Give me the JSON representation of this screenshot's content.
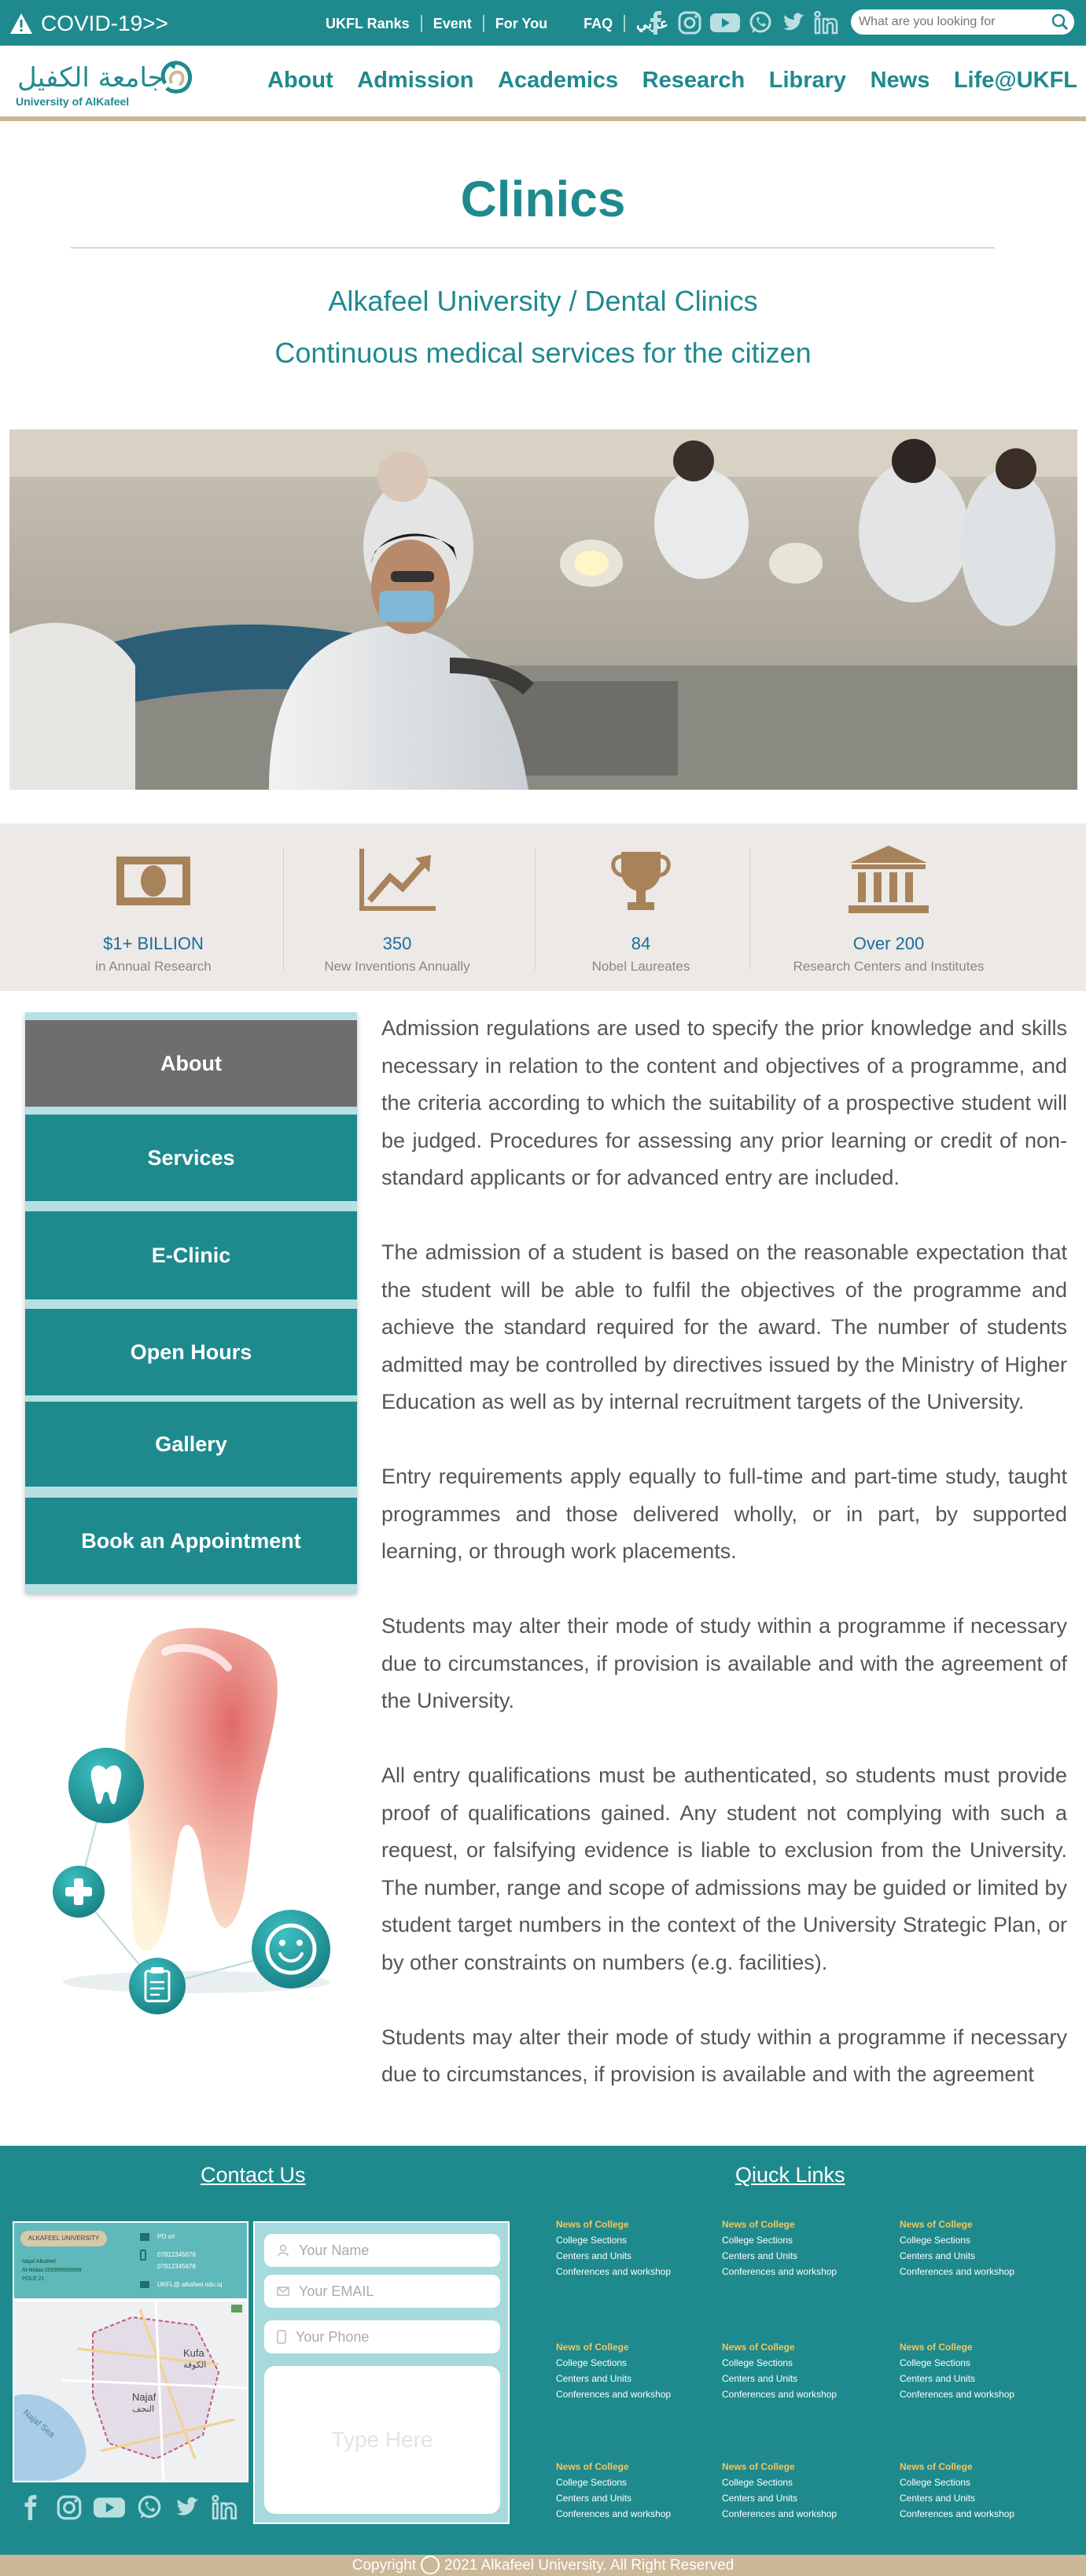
{
  "topbar": {
    "covid_label": "COVID-19>>",
    "links": [
      "UKFL Ranks",
      "Event",
      "For You",
      "FAQ",
      "عربي"
    ],
    "search_placeholder": "What are you looking for"
  },
  "logo": {
    "arabic_text": "جامعة الكفيل",
    "english_text": "University of AlKafeel"
  },
  "nav": [
    "About",
    "Admission",
    "Academics",
    "Research",
    "Library",
    "News",
    "Life@UKFL"
  ],
  "page": {
    "title": "Clinics",
    "subtitle1": "Alkafeel University / Dental Clinics",
    "subtitle2": "Continuous medical services for the citizen"
  },
  "stats": [
    {
      "value": "$1+ BILLION",
      "label": "in Annual Research",
      "icon": "money-icon"
    },
    {
      "value": "350",
      "label": "New Inventions Annually",
      "icon": "chart-up-icon"
    },
    {
      "value": "84",
      "label": "Nobel Laureates",
      "icon": "trophy-icon"
    },
    {
      "value": "Over 200",
      "label": "Research Centers and Institutes",
      "icon": "institute-icon"
    }
  ],
  "sidebar": [
    "About",
    "Services",
    "E-Clinic",
    "Open Hours",
    "Gallery",
    "Book an Appointment"
  ],
  "content": [
    "Admission regulations are used to specify the prior knowledge and skills necessary in relation to the content and objectives of a programme, and the criteria according to which the suitability of a prospective student will be judged. Procedures for assessing any prior learning or credit of non-standard applicants or for advanced entry are included.",
    "The admission of a student is based on the reasonable expectation that the student will be able to fulfil the objectives of the programme and achieve the standard required for the award.  The number of students admitted may be controlled by directives issued by the Ministry of Higher Education as well as by internal recruitment targets of the University.",
    "Entry requirements apply equally to full-time and part-time study, taught programmes and those delivered wholly, or in part, by supported learning, or through work placements.",
    "Students may alter their mode of study within a programme if necessary due to circumstances, if provision is available and with the agreement of the University.",
    "All entry qualifications must be authenticated, so students must provide proof of qualifications gained. Any student not complying with such a request, or falsifying evidence is liable to exclusion from the University. The number, range and scope of admissions may be guided or limited by student target numbers in the context of the University Strategic Plan, or by other constraints on numbers (e.g. facilities).",
    "Students may alter their mode of study within a programme if necessary due to circumstances, if provision is available and with the agreement"
  ],
  "footer": {
    "contact_heading": "Contact Us",
    "quicklinks_heading": "Qiuck Links",
    "card": {
      "name": "ALKAFEEL UNIVERSITY",
      "address": [
        "Najaf Alkafeel",
        "Al-Nidaa 009999999999",
        "POLE 21"
      ],
      "po": "PO s/r",
      "phone1": "07812345678",
      "phone2": "07812345678",
      "email": "UKFL@ alkafeel.edu.iq"
    },
    "map_labels": {
      "kufa_en": "Kufa",
      "kufa_ar": "الكوفة",
      "najaf_en": "Najaf",
      "najaf_ar": "النجف",
      "sea": "Najaf Sea"
    },
    "form": {
      "name": "Your Name",
      "email": "Your EMAIL",
      "phone": "Your Phone",
      "message": "Type Here"
    },
    "quicklinks": [
      {
        "h": "News of College",
        "items": [
          "College Sections",
          "Centers and Units",
          "Conferences and workshop"
        ]
      },
      {
        "h": "News of College",
        "items": [
          "College Sections",
          "Centers and Units",
          "Conferences and workshop"
        ]
      },
      {
        "h": "News of College",
        "items": [
          "College Sections",
          "Centers and Units",
          "Conferences and workshop"
        ]
      },
      {
        "h": "News of College",
        "items": [
          "College Sections",
          "Centers and Units",
          "Conferences and workshop"
        ]
      },
      {
        "h": "News of College",
        "items": [
          "College Sections",
          "Centers and Units",
          "Conferences and workshop"
        ]
      },
      {
        "h": "News of College",
        "items": [
          "College Sections",
          "Centers and Units",
          "Conferences and workshop"
        ]
      },
      {
        "h": "News of College",
        "items": [
          "College Sections",
          "Centers and Units",
          "Conferences and workshop"
        ]
      },
      {
        "h": "News of College",
        "items": [
          "College Sections",
          "Centers and Units",
          "Conferences and workshop"
        ]
      },
      {
        "h": "News of College",
        "items": [
          "College Sections",
          "Centers and Units",
          "Conferences and workshop"
        ]
      }
    ],
    "copyright_prefix": "Copyright",
    "copyright_text": "2021 Alkafeel University. All Right Reserved"
  },
  "colors": {
    "teal": "#1f8a8e",
    "gold": "#cbb898",
    "active": "#6e6e70",
    "stat_blue": "#1d6d9a",
    "icon_brown": "#a8835a"
  }
}
